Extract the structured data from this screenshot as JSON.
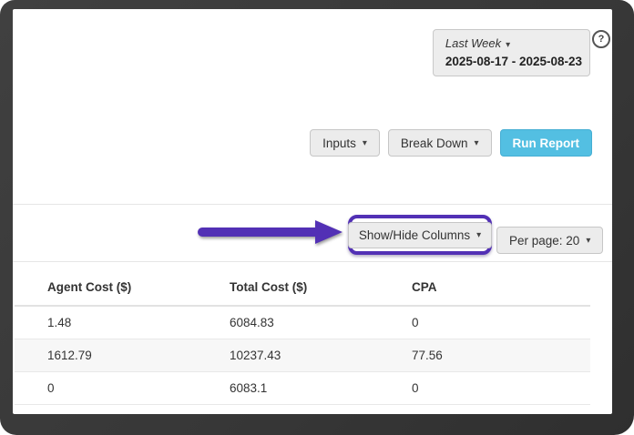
{
  "icons": {
    "caret_down": "▾",
    "help": "?"
  },
  "date_picker": {
    "preset": "Last Week",
    "range": "2025-08-17 - 2025-08-23"
  },
  "toolbar": {
    "inputs": "Inputs",
    "break_down": "Break Down",
    "run_report": "Run Report"
  },
  "controls": {
    "show_hide_columns": "Show/Hide Columns",
    "per_page": "Per page: 20"
  },
  "table": {
    "columns": [
      "Agent Cost ($)",
      "Total Cost ($)",
      "CPA"
    ],
    "rows": [
      [
        "1.48",
        "6084.83",
        "0"
      ],
      [
        "1612.79",
        "10237.43",
        "77.56"
      ],
      [
        "0",
        "6083.1",
        "0"
      ]
    ]
  },
  "colors": {
    "run_report_bg": "#53bfe2",
    "highlight_purple": "#5230b5",
    "frame_dark": "#383838",
    "stripe_gray": "#f7f7f7"
  }
}
